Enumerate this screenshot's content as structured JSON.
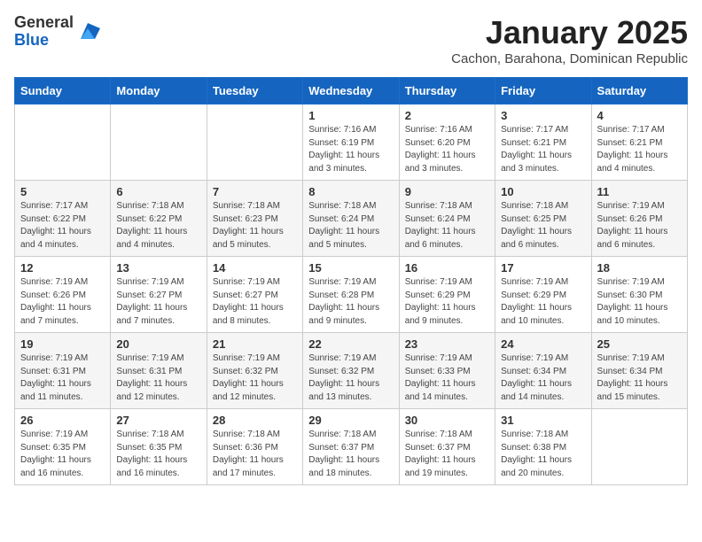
{
  "logo": {
    "general": "General",
    "blue": "Blue"
  },
  "title": "January 2025",
  "subtitle": "Cachon, Barahona, Dominican Republic",
  "days_of_week": [
    "Sunday",
    "Monday",
    "Tuesday",
    "Wednesday",
    "Thursday",
    "Friday",
    "Saturday"
  ],
  "weeks": [
    [
      {
        "day": "",
        "info": ""
      },
      {
        "day": "",
        "info": ""
      },
      {
        "day": "",
        "info": ""
      },
      {
        "day": "1",
        "info": "Sunrise: 7:16 AM\nSunset: 6:19 PM\nDaylight: 11 hours and 3 minutes."
      },
      {
        "day": "2",
        "info": "Sunrise: 7:16 AM\nSunset: 6:20 PM\nDaylight: 11 hours and 3 minutes."
      },
      {
        "day": "3",
        "info": "Sunrise: 7:17 AM\nSunset: 6:21 PM\nDaylight: 11 hours and 3 minutes."
      },
      {
        "day": "4",
        "info": "Sunrise: 7:17 AM\nSunset: 6:21 PM\nDaylight: 11 hours and 4 minutes."
      }
    ],
    [
      {
        "day": "5",
        "info": "Sunrise: 7:17 AM\nSunset: 6:22 PM\nDaylight: 11 hours and 4 minutes."
      },
      {
        "day": "6",
        "info": "Sunrise: 7:18 AM\nSunset: 6:22 PM\nDaylight: 11 hours and 4 minutes."
      },
      {
        "day": "7",
        "info": "Sunrise: 7:18 AM\nSunset: 6:23 PM\nDaylight: 11 hours and 5 minutes."
      },
      {
        "day": "8",
        "info": "Sunrise: 7:18 AM\nSunset: 6:24 PM\nDaylight: 11 hours and 5 minutes."
      },
      {
        "day": "9",
        "info": "Sunrise: 7:18 AM\nSunset: 6:24 PM\nDaylight: 11 hours and 6 minutes."
      },
      {
        "day": "10",
        "info": "Sunrise: 7:18 AM\nSunset: 6:25 PM\nDaylight: 11 hours and 6 minutes."
      },
      {
        "day": "11",
        "info": "Sunrise: 7:19 AM\nSunset: 6:26 PM\nDaylight: 11 hours and 6 minutes."
      }
    ],
    [
      {
        "day": "12",
        "info": "Sunrise: 7:19 AM\nSunset: 6:26 PM\nDaylight: 11 hours and 7 minutes."
      },
      {
        "day": "13",
        "info": "Sunrise: 7:19 AM\nSunset: 6:27 PM\nDaylight: 11 hours and 7 minutes."
      },
      {
        "day": "14",
        "info": "Sunrise: 7:19 AM\nSunset: 6:27 PM\nDaylight: 11 hours and 8 minutes."
      },
      {
        "day": "15",
        "info": "Sunrise: 7:19 AM\nSunset: 6:28 PM\nDaylight: 11 hours and 9 minutes."
      },
      {
        "day": "16",
        "info": "Sunrise: 7:19 AM\nSunset: 6:29 PM\nDaylight: 11 hours and 9 minutes."
      },
      {
        "day": "17",
        "info": "Sunrise: 7:19 AM\nSunset: 6:29 PM\nDaylight: 11 hours and 10 minutes."
      },
      {
        "day": "18",
        "info": "Sunrise: 7:19 AM\nSunset: 6:30 PM\nDaylight: 11 hours and 10 minutes."
      }
    ],
    [
      {
        "day": "19",
        "info": "Sunrise: 7:19 AM\nSunset: 6:31 PM\nDaylight: 11 hours and 11 minutes."
      },
      {
        "day": "20",
        "info": "Sunrise: 7:19 AM\nSunset: 6:31 PM\nDaylight: 11 hours and 12 minutes."
      },
      {
        "day": "21",
        "info": "Sunrise: 7:19 AM\nSunset: 6:32 PM\nDaylight: 11 hours and 12 minutes."
      },
      {
        "day": "22",
        "info": "Sunrise: 7:19 AM\nSunset: 6:32 PM\nDaylight: 11 hours and 13 minutes."
      },
      {
        "day": "23",
        "info": "Sunrise: 7:19 AM\nSunset: 6:33 PM\nDaylight: 11 hours and 14 minutes."
      },
      {
        "day": "24",
        "info": "Sunrise: 7:19 AM\nSunset: 6:34 PM\nDaylight: 11 hours and 14 minutes."
      },
      {
        "day": "25",
        "info": "Sunrise: 7:19 AM\nSunset: 6:34 PM\nDaylight: 11 hours and 15 minutes."
      }
    ],
    [
      {
        "day": "26",
        "info": "Sunrise: 7:19 AM\nSunset: 6:35 PM\nDaylight: 11 hours and 16 minutes."
      },
      {
        "day": "27",
        "info": "Sunrise: 7:18 AM\nSunset: 6:35 PM\nDaylight: 11 hours and 16 minutes."
      },
      {
        "day": "28",
        "info": "Sunrise: 7:18 AM\nSunset: 6:36 PM\nDaylight: 11 hours and 17 minutes."
      },
      {
        "day": "29",
        "info": "Sunrise: 7:18 AM\nSunset: 6:37 PM\nDaylight: 11 hours and 18 minutes."
      },
      {
        "day": "30",
        "info": "Sunrise: 7:18 AM\nSunset: 6:37 PM\nDaylight: 11 hours and 19 minutes."
      },
      {
        "day": "31",
        "info": "Sunrise: 7:18 AM\nSunset: 6:38 PM\nDaylight: 11 hours and 20 minutes."
      },
      {
        "day": "",
        "info": ""
      }
    ]
  ]
}
